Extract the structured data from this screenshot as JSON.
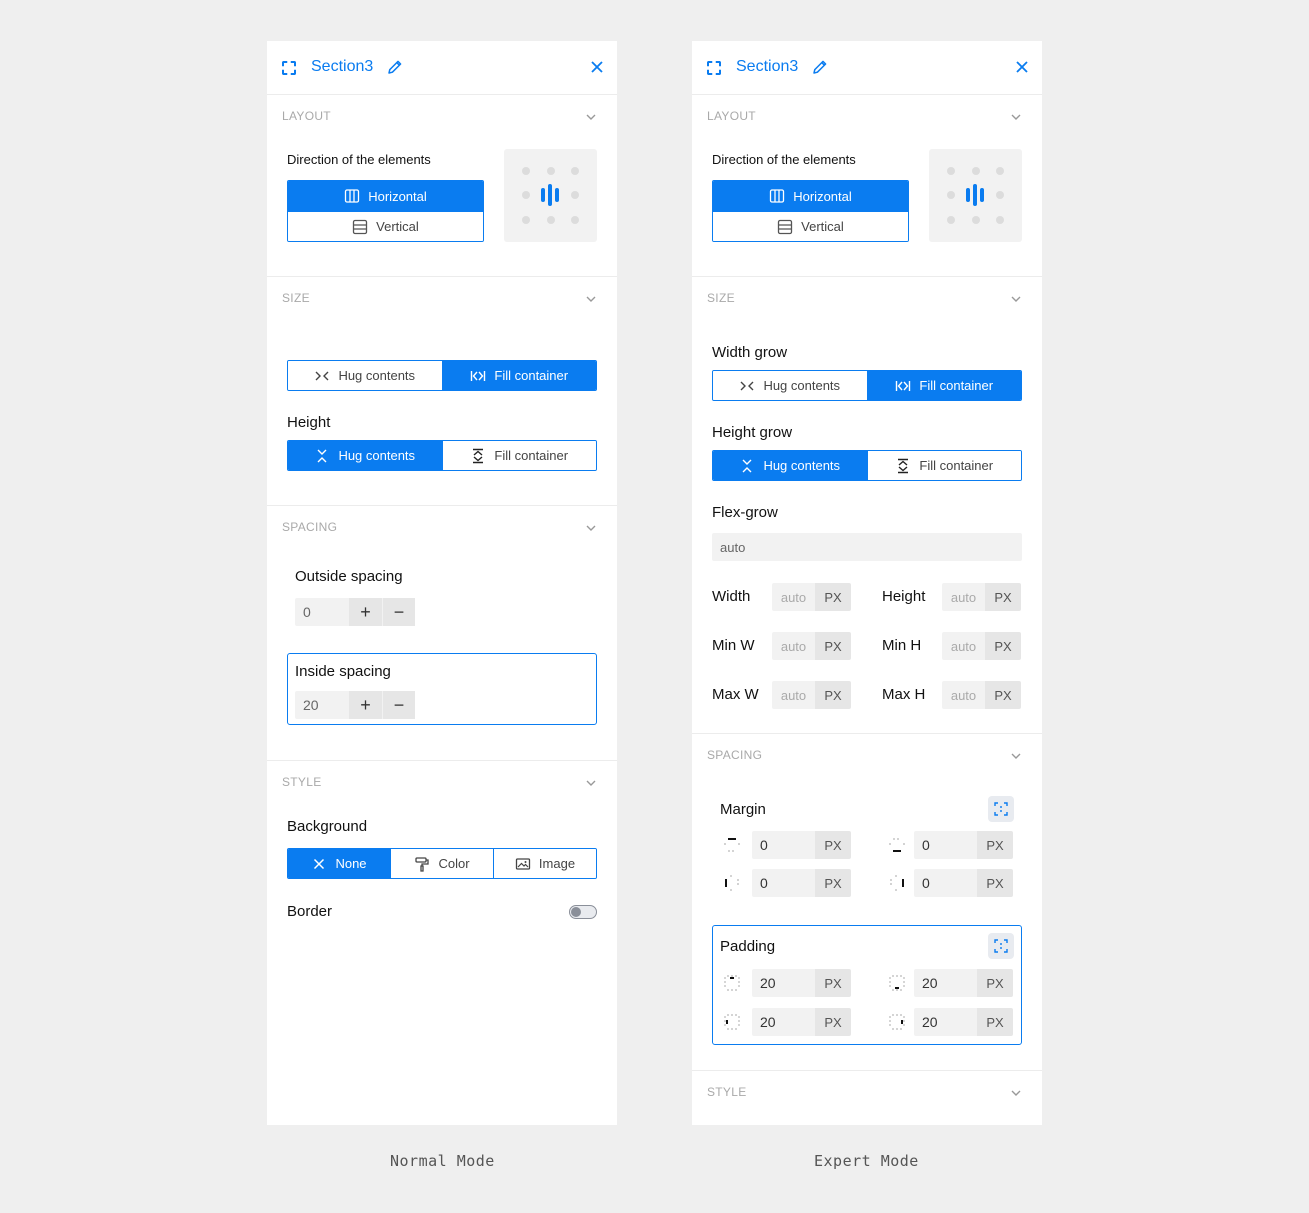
{
  "accent_color": "#0a7cf0",
  "normal": {
    "header": {
      "title": "Section3"
    },
    "layout": {
      "section_label": "LAYOUT",
      "direction_label": "Direction of the elements",
      "options": [
        "Horizontal",
        "Vertical"
      ],
      "selected": "Horizontal"
    },
    "size": {
      "section_label": "SIZE",
      "width_options": [
        "Hug contents",
        "Fill container"
      ],
      "width_selected": "Fill container",
      "height_label": "Height",
      "height_options": [
        "Hug contents",
        "Fill container"
      ],
      "height_selected": "Hug contents"
    },
    "spacing": {
      "section_label": "SPACING",
      "outside_label": "Outside spacing",
      "outside_value": "0",
      "inside_label": "Inside spacing",
      "inside_value": "20"
    },
    "style": {
      "section_label": "STYLE",
      "background_label": "Background",
      "background_options": [
        "None",
        "Color",
        "Image"
      ],
      "background_selected": "None",
      "border_label": "Border",
      "border_on": false
    }
  },
  "expert": {
    "header": {
      "title": "Section3"
    },
    "layout": {
      "section_label": "LAYOUT",
      "direction_label": "Direction of the elements",
      "options": [
        "Horizontal",
        "Vertical"
      ],
      "selected": "Horizontal"
    },
    "size": {
      "section_label": "SIZE",
      "width_grow_label": "Width grow",
      "width_options": [
        "Hug contents",
        "Fill container"
      ],
      "width_selected": "Fill container",
      "height_grow_label": "Height grow",
      "height_options": [
        "Hug contents",
        "Fill container"
      ],
      "height_selected": "Hug contents",
      "flex_grow_label": "Flex-grow",
      "flex_grow_value": "auto",
      "unit": "PX",
      "dims": [
        {
          "label": "Width",
          "value": "auto"
        },
        {
          "label": "Height",
          "value": "auto"
        },
        {
          "label": "Min W",
          "value": "auto"
        },
        {
          "label": "Min H",
          "value": "auto"
        },
        {
          "label": "Max W",
          "value": "auto"
        },
        {
          "label": "Max H",
          "value": "auto"
        }
      ]
    },
    "spacing": {
      "section_label": "SPACING",
      "margin_label": "Margin",
      "margin_values": [
        "0",
        "0",
        "0",
        "0"
      ],
      "padding_label": "Padding",
      "padding_values": [
        "20",
        "20",
        "20",
        "20"
      ],
      "unit": "PX"
    },
    "style": {
      "section_label": "STYLE"
    }
  },
  "captions": {
    "normal": "Normal Mode",
    "expert": "Expert Mode"
  }
}
